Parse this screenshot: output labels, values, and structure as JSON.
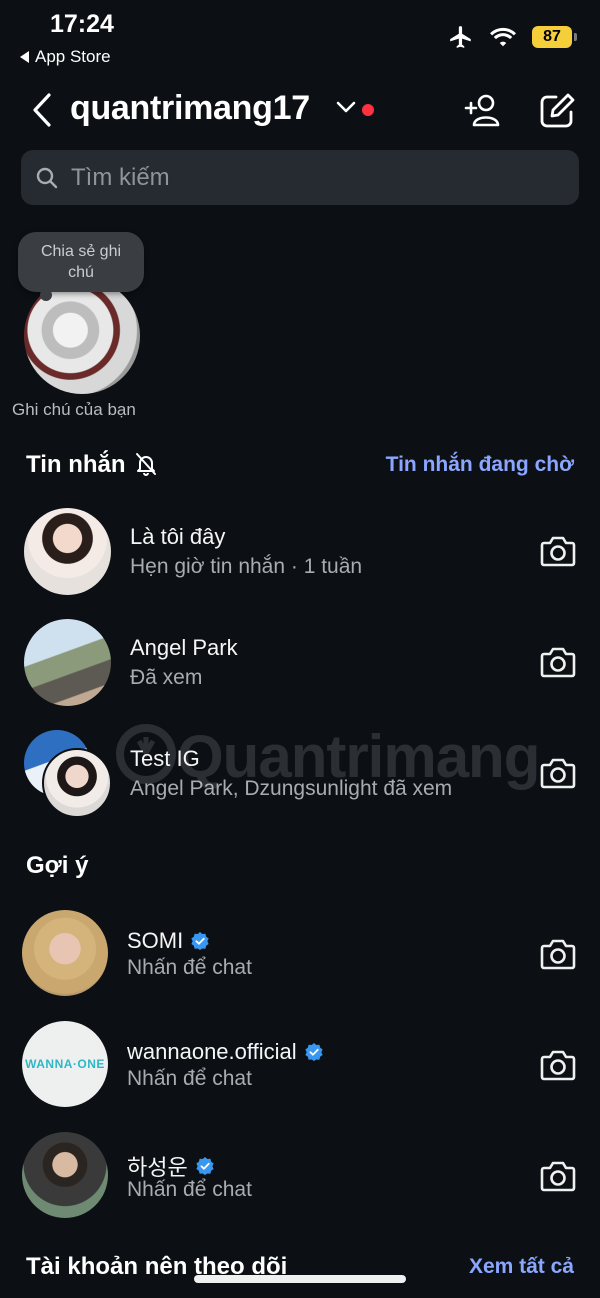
{
  "status_bar": {
    "time": "17:24",
    "back_app": "App Store",
    "battery": "87",
    "icons": [
      "airplane-icon",
      "wifi-icon",
      "battery-icon"
    ]
  },
  "header": {
    "username": "quantrimang17",
    "icons": [
      "back-chevron-icon",
      "chevron-down-icon",
      "add-person-icon",
      "compose-icon"
    ]
  },
  "search": {
    "placeholder": "Tìm kiếm"
  },
  "note": {
    "bubble_text": "Chia sẻ ghi chú",
    "label": "Ghi chú của bạn"
  },
  "messages": {
    "title": "Tin nhắn",
    "requests_link": "Tin nhắn đang chờ",
    "items": [
      {
        "name": "Là tôi đây",
        "subtitle": "Hẹn giờ tin nhắn · 1 tuần"
      },
      {
        "name": "Angel Park",
        "subtitle": "Đã xem"
      },
      {
        "name": "Test IG",
        "subtitle": "Angel Park, Dzungsunlight đã xem"
      }
    ]
  },
  "suggestions": {
    "title": "Gợi ý",
    "items": [
      {
        "name": "SOMI",
        "subtitle": "Nhấn để chat",
        "verified": true
      },
      {
        "name": "wannaone.official",
        "subtitle": "Nhấn để chat",
        "verified": true,
        "avatar_text": "WANNA·ONE"
      },
      {
        "name": "하성운",
        "subtitle": "Nhấn để chat",
        "verified": true
      }
    ]
  },
  "accounts": {
    "title": "Tài khoản nên theo dõi",
    "see_all": "Xem tất cả"
  },
  "watermark": "Quantrimang",
  "colors": {
    "background": "#0c1014",
    "link": "#8aa6ff",
    "notification_dot": "#ff3040",
    "verified": "#3897f0",
    "battery": "#f5cf3a"
  }
}
